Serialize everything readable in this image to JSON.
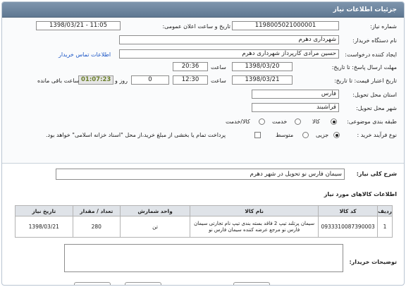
{
  "header": {
    "title": "جزئیات اطلاعات نیاز"
  },
  "form": {
    "need_number": {
      "label": "شماره نیاز:",
      "value": "1198005021000001"
    },
    "announce_datetime": {
      "label": "تاریخ و ساعت اعلان عمومی:",
      "value": "1398/03/21 - 11:05"
    },
    "buyer_org": {
      "label": "نام دستگاه خریدار:",
      "value": "شهرداری دهرم"
    },
    "requester": {
      "label": "ایجاد کننده درخواست:",
      "value": "حسین مرادی کارپرداز شهرداری دهرم",
      "contact_link": "اطلاعات تماس خریدار"
    },
    "reply_deadline": {
      "label": "مهلت ارسال پاسخ: تا تاریخ:",
      "date": "1398/03/20",
      "time_label": "ساعت",
      "time": "20:36"
    },
    "price_validity": {
      "label": "تاریخ اعتبار قیمت: تا تاریخ:",
      "date": "1398/03/21",
      "time_label": "ساعت",
      "time": "12:30",
      "days": "0",
      "days_label": "روز و",
      "remaining": "01:07:23",
      "remaining_label": "ساعت باقی مانده"
    },
    "province": {
      "label": "استان محل تحویل:",
      "value": "فارس"
    },
    "city": {
      "label": "شهر محل تحویل:",
      "value": "قراشبند"
    },
    "category": {
      "label": "طبقه بندی موضوعی:",
      "options": [
        "کالا",
        "خدمت",
        "کالا/خدمت"
      ],
      "selected": "کالا"
    },
    "purchase_process": {
      "label": "نوع فرآیند خرید :",
      "options": [
        "جزیی",
        "متوسط"
      ],
      "selected": "جزیی",
      "note": "پرداخت تمام یا بخشی از مبلغ خرید،از محل \"اسناد خزانه اسلامی\" خواهد بود."
    }
  },
  "summary": {
    "label": "شرح کلی نیاز:",
    "value": "سیمان فارس نو تحویل در شهر دهرم"
  },
  "items": {
    "title": "اطلاعات کالاهای مورد نیاز",
    "columns": [
      "ردیف",
      "کد کالا",
      "نام کالا",
      "واحد شمارش",
      "تعداد / مقدار",
      "تاریخ نیاز"
    ],
    "rows": [
      {
        "row": "1",
        "code": "0933310087390003",
        "name": "سیمان پرتلند تیپ 2 فاقد بسته بندی تیپ نام تجارتی سیمان فارس نو مرجع عرضه کننده سیمان فارس نو",
        "unit": "تن",
        "qty": "280",
        "date": "1398/03/21"
      }
    ]
  },
  "buyer_notes": {
    "label": "توضیحات خریدار:",
    "value": ""
  }
}
